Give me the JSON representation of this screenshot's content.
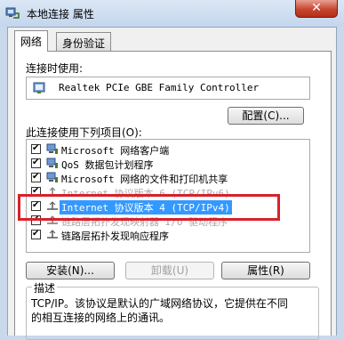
{
  "window": {
    "title": "本地连接 属性",
    "close_symbol": "✕"
  },
  "tabs": [
    {
      "label": "网络"
    },
    {
      "label": "身份验证"
    }
  ],
  "connect_using": {
    "label": "连接时使用:",
    "adapter": "Realtek PCIe GBE Family Controller",
    "configure_button": "配置(C)..."
  },
  "items_label": "此连接使用下列项目(O):",
  "items": [
    {
      "text": "Microsoft 网络客户端",
      "checked": true,
      "icon": "network-client-icon"
    },
    {
      "text": "QoS 数据包计划程序",
      "checked": true,
      "icon": "qos-icon"
    },
    {
      "text": "Microsoft 网络的文件和打印机共享",
      "checked": true,
      "icon": "file-share-icon"
    },
    {
      "text": "Internet 协议版本 6 (TCP/IPv6)",
      "checked": true,
      "icon": "protocol-icon"
    },
    {
      "text": "Internet 协议版本 4 (TCP/IPv4)",
      "checked": true,
      "icon": "protocol-icon",
      "selected": true
    },
    {
      "text": "链路层拓扑发现映射器 I/O 驱动程序",
      "checked": true,
      "icon": "protocol-icon"
    },
    {
      "text": "链路层拓扑发现响应程序",
      "checked": true,
      "icon": "protocol-icon"
    }
  ],
  "buttons": {
    "install": "安装(N)...",
    "uninstall": "卸载(U)",
    "properties": "属性(R)"
  },
  "description": {
    "label": "描述",
    "line1": "TCP/IP。该协议是默认的广域网络协议，它提供在不同",
    "line2": "的相互连接的网络上的通讯。"
  },
  "colors": {
    "highlight_border": "#d9202a",
    "selection": "#3399ff",
    "close_button": "#c7462f"
  }
}
